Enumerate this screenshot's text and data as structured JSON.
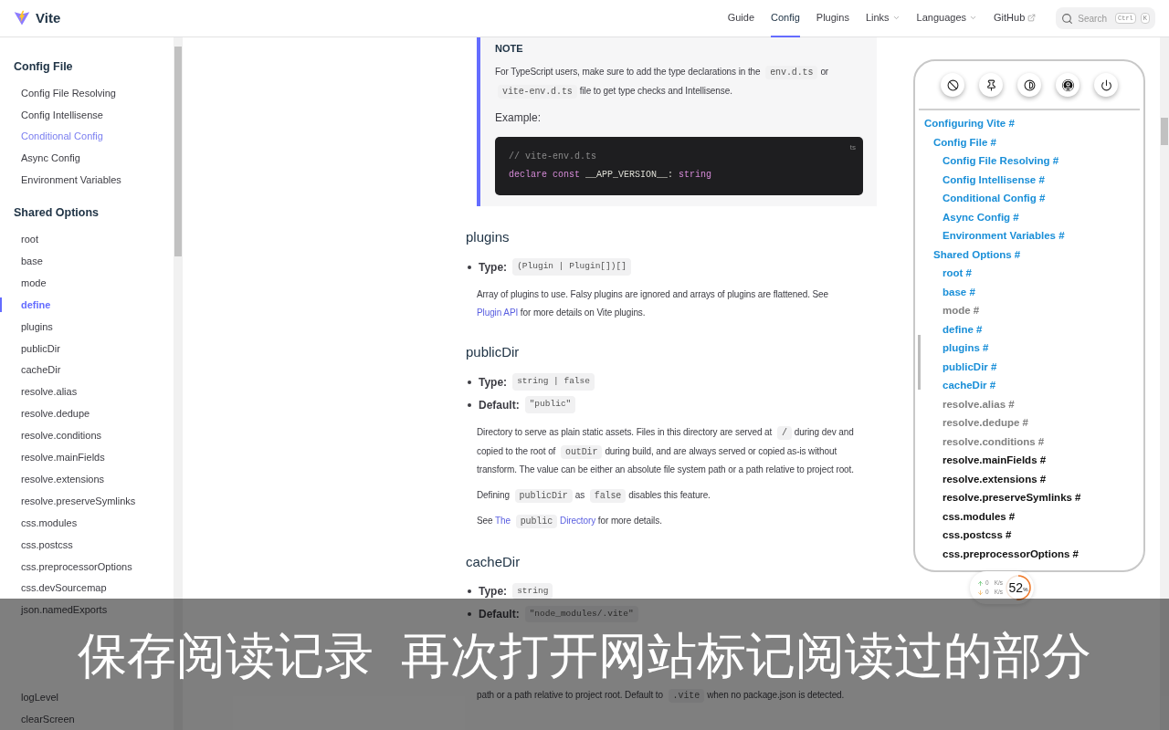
{
  "nav": {
    "logo": "Vite",
    "links": [
      {
        "label": "Guide",
        "kind": "link",
        "selected": false
      },
      {
        "label": "Config",
        "kind": "link",
        "selected": true
      },
      {
        "label": "Plugins",
        "kind": "link",
        "selected": false
      },
      {
        "label": "Links",
        "kind": "dropdown",
        "selected": false
      },
      {
        "label": "Languages",
        "kind": "dropdown",
        "selected": false
      },
      {
        "label": "GitHub",
        "kind": "external",
        "selected": false
      }
    ],
    "search": {
      "placeholder": "Search",
      "keys": [
        "Ctrl",
        "K"
      ]
    }
  },
  "sidebar": {
    "groups": [
      {
        "title": "Config File",
        "items": [
          {
            "label": "Config File Resolving",
            "selected": false,
            "hovered": false
          },
          {
            "label": "Config Intellisense",
            "selected": false,
            "hovered": false
          },
          {
            "label": "Conditional Config",
            "selected": false,
            "hovered": true
          },
          {
            "label": "Async Config",
            "selected": false,
            "hovered": false
          },
          {
            "label": "Environment Variables",
            "selected": false,
            "hovered": false
          }
        ]
      },
      {
        "title": "Shared Options",
        "items": [
          {
            "label": "root",
            "selected": false,
            "hovered": false
          },
          {
            "label": "base",
            "selected": false,
            "hovered": false
          },
          {
            "label": "mode",
            "selected": false,
            "hovered": false
          },
          {
            "label": "define",
            "selected": true,
            "hovered": false
          },
          {
            "label": "plugins",
            "selected": false,
            "hovered": false
          },
          {
            "label": "publicDir",
            "selected": false,
            "hovered": false
          },
          {
            "label": "cacheDir",
            "selected": false,
            "hovered": false
          },
          {
            "label": "resolve.alias",
            "selected": false,
            "hovered": false
          },
          {
            "label": "resolve.dedupe",
            "selected": false,
            "hovered": false
          },
          {
            "label": "resolve.conditions",
            "selected": false,
            "hovered": false
          },
          {
            "label": "resolve.mainFields",
            "selected": false,
            "hovered": false
          },
          {
            "label": "resolve.extensions",
            "selected": false,
            "hovered": false
          },
          {
            "label": "resolve.preserveSymlinks",
            "selected": false,
            "hovered": false
          },
          {
            "label": "css.modules",
            "selected": false,
            "hovered": false
          },
          {
            "label": "css.postcss",
            "selected": false,
            "hovered": false
          },
          {
            "label": "css.preprocessorOptions",
            "selected": false,
            "hovered": false
          },
          {
            "label": "css.devSourcemap",
            "selected": false,
            "hovered": false
          },
          {
            "label": "json.namedExports",
            "selected": false,
            "hovered": false
          }
        ],
        "items_below_caption": [
          {
            "label": "logLevel",
            "selected": false,
            "hovered": false
          },
          {
            "label": "clearScreen",
            "selected": false,
            "hovered": false
          }
        ]
      }
    ]
  },
  "note": {
    "title": "NOTE",
    "paragraph": [
      {
        "kind": "text",
        "text": "For TypeScript users, make sure to add the type declarations in the"
      },
      {
        "kind": "code",
        "text": "env.d.ts"
      },
      {
        "kind": "text",
        "text": "or"
      },
      {
        "kind": "code",
        "text": "vite-env.d.ts"
      },
      {
        "kind": "text",
        "text": "file to get type checks and Intellisense."
      }
    ],
    "example_label": "Example:",
    "code": {
      "lang": "ts",
      "lines": [
        [
          {
            "kind": "comment",
            "text": "// vite-env.d.ts"
          }
        ],
        [
          {
            "kind": "keyword",
            "text": "declare const "
          },
          {
            "kind": "plain",
            "text": "__APP_VERSION__: "
          },
          {
            "kind": "keyword",
            "text": "string"
          }
        ]
      ]
    }
  },
  "sections": [
    {
      "heading": "plugins",
      "bullets": [
        {
          "label": "Type:",
          "code": "(Plugin | Plugin[])[]"
        }
      ],
      "paragraphs": [
        [
          {
            "kind": "text",
            "text": "Array of plugins to use. Falsy plugins are ignored and arrays of plugins are flattened. See"
          },
          {
            "kind": "link",
            "text": "Plugin API"
          },
          {
            "kind": "text",
            "text": "for more details on Vite plugins."
          }
        ]
      ]
    },
    {
      "heading": "publicDir",
      "bullets": [
        {
          "label": "Type:",
          "code": "string | false"
        },
        {
          "label": "Default:",
          "code": "\"public\""
        }
      ],
      "paragraphs": [
        [
          {
            "kind": "text",
            "text": "Directory to serve as plain static assets. Files in this directory are served at"
          },
          {
            "kind": "code",
            "text": "/"
          },
          {
            "kind": "text",
            "text": "during dev and copied to the root of"
          },
          {
            "kind": "code",
            "text": "outDir"
          },
          {
            "kind": "text",
            "text": "during build, and are always served or copied as-is without transform. The value can be either an absolute file system path or a path relative to project root."
          }
        ],
        [
          {
            "kind": "text",
            "text": "Defining"
          },
          {
            "kind": "code",
            "text": "publicDir"
          },
          {
            "kind": "text",
            "text": "as"
          },
          {
            "kind": "code",
            "text": "false"
          },
          {
            "kind": "text",
            "text": "disables this feature."
          }
        ],
        [
          {
            "kind": "text",
            "text": "See"
          },
          {
            "kind": "link",
            "text": "The"
          },
          {
            "kind": "code",
            "text": "public"
          },
          {
            "kind": "link",
            "text": "Directory"
          },
          {
            "kind": "text",
            "text": "for more details."
          }
        ]
      ]
    },
    {
      "heading": "cacheDir",
      "bullets": [
        {
          "label": "Type:",
          "code": "string"
        },
        {
          "label": "Default:",
          "code": "\"node_modules/.vite\""
        }
      ],
      "paragraphs_below_caption": [
        [
          {
            "kind": "text",
            "text": "path or a path relative to project root. Default to"
          },
          {
            "kind": "code",
            "text": ".vite"
          },
          {
            "kind": "text",
            "text": "when no package.json is detected."
          }
        ]
      ]
    }
  ],
  "toc": {
    "tools": [
      {
        "kind": "block",
        "selected": false
      },
      {
        "kind": "pin",
        "selected": false
      },
      {
        "kind": "contrast",
        "selected": false
      },
      {
        "kind": "user",
        "selected": true
      },
      {
        "kind": "power",
        "selected": false
      }
    ],
    "items": [
      {
        "label": "Configuring Vite #",
        "color": "#1a8fd8",
        "children": [
          {
            "label": "Config File #",
            "color": "#1a8fd8",
            "children": [
              {
                "label": "Config File Resolving #",
                "color": "#1a8fd8"
              },
              {
                "label": "Config Intellisense #",
                "color": "#1a8fd8"
              },
              {
                "label": "Conditional Config #",
                "color": "#1a8fd8"
              },
              {
                "label": "Async Config #",
                "color": "#1a8fd8"
              },
              {
                "label": "Environment Variables #",
                "color": "#1a8fd8"
              }
            ]
          },
          {
            "label": "Shared Options #",
            "color": "#1a8fd8",
            "children": [
              {
                "label": "root #",
                "color": "#1a8fd8"
              },
              {
                "label": "base #",
                "color": "#1a8fd8"
              },
              {
                "label": "mode #",
                "color": "#808080"
              },
              {
                "label": "define #",
                "color": "#1a8fd8"
              },
              {
                "label": "plugins #",
                "color": "#1a8fd8"
              },
              {
                "label": "publicDir #",
                "color": "#1a8fd8"
              },
              {
                "label": "cacheDir #",
                "color": "#1a8fd8"
              },
              {
                "label": "resolve.alias #",
                "color": "#808080"
              },
              {
                "label": "resolve.dedupe #",
                "color": "#808080"
              },
              {
                "label": "resolve.conditions #",
                "color": "#808080"
              },
              {
                "label": "resolve.mainFields #",
                "color": "#111111"
              },
              {
                "label": "resolve.extensions #",
                "color": "#111111"
              },
              {
                "label": "resolve.preserveSymlinks #",
                "color": "#111111"
              },
              {
                "label": "css.modules #",
                "color": "#111111"
              },
              {
                "label": "css.postcss #",
                "color": "#111111"
              },
              {
                "label": "css.preprocessorOptions #",
                "color": "#111111"
              }
            ]
          }
        ]
      }
    ]
  },
  "speed": {
    "up": "0",
    "up_unit": "K/s",
    "down": "0",
    "down_unit": "K/s",
    "percent": "52",
    "percent_unit": "%"
  },
  "caption": [
    "保存阅读记录",
    "再次打开网站标记阅读过的部分"
  ]
}
